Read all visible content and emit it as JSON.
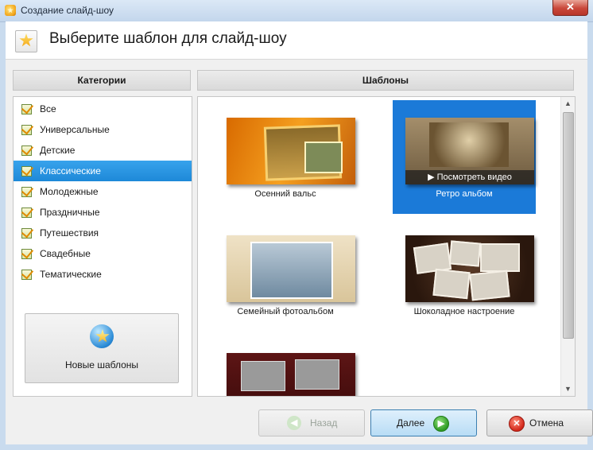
{
  "window": {
    "title": "Создание слайд-шоу",
    "close_label": "✕"
  },
  "header": {
    "heading": "Выберите шаблон для слайд-шоу"
  },
  "categories": {
    "title": "Категории",
    "items": [
      {
        "label": "Все"
      },
      {
        "label": "Универсальные"
      },
      {
        "label": "Детские"
      },
      {
        "label": "Классические",
        "selected": true
      },
      {
        "label": "Молодежные"
      },
      {
        "label": "Праздничные"
      },
      {
        "label": "Путешествия"
      },
      {
        "label": "Свадебные"
      },
      {
        "label": "Тематические"
      }
    ],
    "new_templates_label": "Новые шаблоны"
  },
  "templates": {
    "title": "Шаблоны",
    "items": [
      {
        "name": "Осенний вальс"
      },
      {
        "name": "Ретро альбом",
        "selected": true,
        "overlay": "Посмотреть видео"
      },
      {
        "name": "Семейный фотоальбом"
      },
      {
        "name": "Шоколадное настроение"
      }
    ]
  },
  "footer": {
    "back_label": "Назад",
    "next_label": "Далее",
    "cancel_label": "Отмена"
  },
  "colors": {
    "selection": "#1d89d8",
    "next_button": "#b8dcf5"
  }
}
